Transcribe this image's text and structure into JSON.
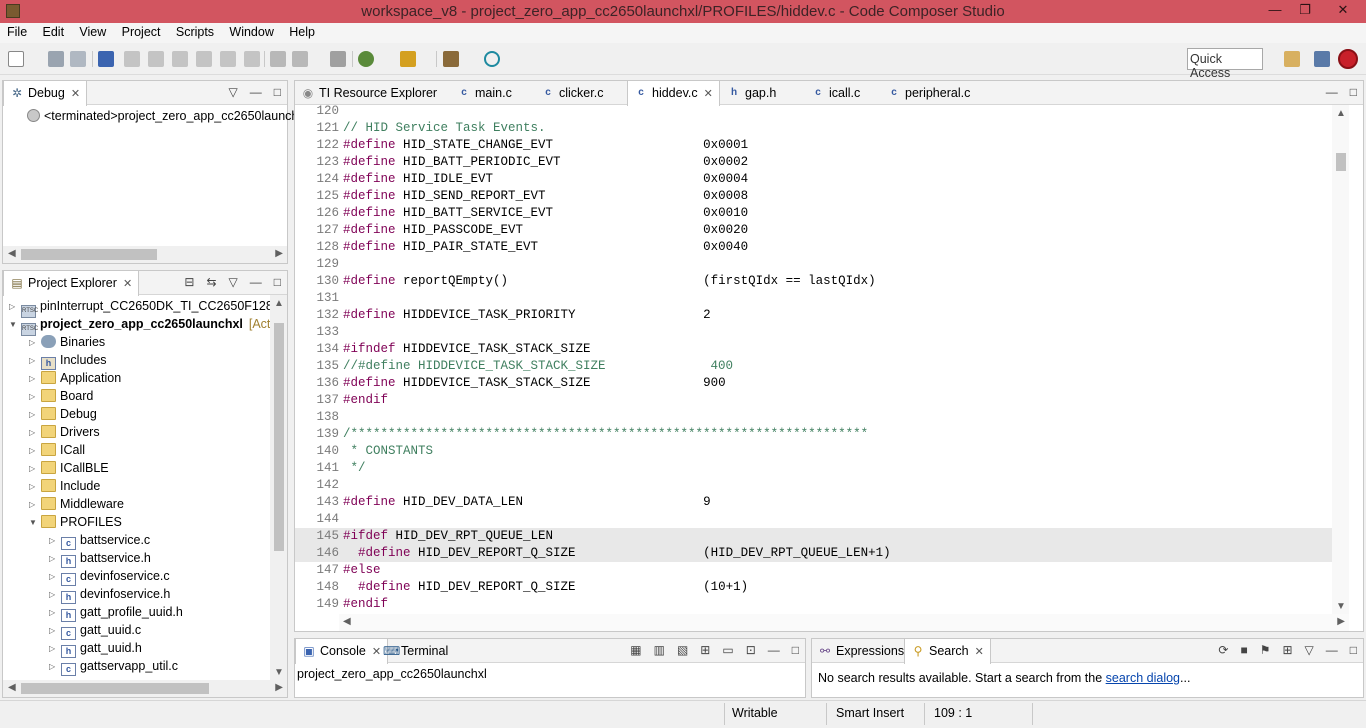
{
  "window": {
    "title": "workspace_v8 - project_zero_app_cc2650launchxl/PROFILES/hiddev.c - Code Composer Studio",
    "min_glyph": "—",
    "restore_glyph": "❐",
    "close_glyph": "✕"
  },
  "menu": [
    "File",
    "Edit",
    "View",
    "Project",
    "Scripts",
    "Window",
    "Help"
  ],
  "quick_access": "Quick Access",
  "debug_view": {
    "tab_label": "Debug",
    "item": "<terminated>project_zero_app_cc2650launch"
  },
  "project_explorer": {
    "tab_label": "Project Explorer",
    "items": [
      {
        "label": "pinInterrupt_CC2650DK_TI_CC2650F128",
        "icon": "project-icon",
        "bold": false
      },
      {
        "label": "project_zero_app_cc2650launchxl",
        "suffix": "[Activ",
        "icon": "project-icon",
        "bold": true
      },
      {
        "label": "Binaries",
        "icon": "binaries-icon"
      },
      {
        "label": "Includes",
        "icon": "includes-icon"
      },
      {
        "label": "Application",
        "icon": "folder-icon"
      },
      {
        "label": "Board",
        "icon": "folder-icon"
      },
      {
        "label": "Debug",
        "icon": "folder-icon"
      },
      {
        "label": "Drivers",
        "icon": "folder-icon"
      },
      {
        "label": "ICall",
        "icon": "folder-icon"
      },
      {
        "label": "ICallBLE",
        "icon": "folder-icon"
      },
      {
        "label": "Include",
        "icon": "folder-icon"
      },
      {
        "label": "Middleware",
        "icon": "folder-icon"
      },
      {
        "label": "PROFILES",
        "icon": "folder-icon"
      },
      {
        "label": "battservice.c",
        "icon": "c-file-icon"
      },
      {
        "label": "battservice.h",
        "icon": "h-file-icon"
      },
      {
        "label": "devinfoservice.c",
        "icon": "c-file-icon"
      },
      {
        "label": "devinfoservice.h",
        "icon": "h-file-icon"
      },
      {
        "label": "gatt_profile_uuid.h",
        "icon": "h-file-icon"
      },
      {
        "label": "gatt_uuid.c",
        "icon": "c-file-icon"
      },
      {
        "label": "gatt_uuid.h",
        "icon": "h-file-icon"
      },
      {
        "label": "gattservapp_util.c",
        "icon": "c-file-icon"
      }
    ]
  },
  "editor": {
    "tabs": [
      {
        "label": "TI Resource Explorer",
        "icon": "resource-explorer-icon"
      },
      {
        "label": "main.c",
        "icon": "c-file-icon"
      },
      {
        "label": "clicker.c",
        "icon": "c-file-icon"
      },
      {
        "label": "hiddev.c",
        "icon": "c-file-icon",
        "active": true
      },
      {
        "label": "gap.h",
        "icon": "h-file-icon"
      },
      {
        "label": "icall.c",
        "icon": "c-file-icon"
      },
      {
        "label": "peripheral.c",
        "icon": "c-file-icon"
      }
    ],
    "lines": [
      {
        "n": "120",
        "text": ""
      },
      {
        "n": "121",
        "text": "// HID Service Task Events.",
        "kind": "comment"
      },
      {
        "n": "122",
        "text": "#define HID_STATE_CHANGE_EVT                    0x0001",
        "kind": "define"
      },
      {
        "n": "123",
        "text": "#define HID_BATT_PERIODIC_EVT                   0x0002",
        "kind": "define"
      },
      {
        "n": "124",
        "text": "#define HID_IDLE_EVT                            0x0004",
        "kind": "define"
      },
      {
        "n": "125",
        "text": "#define HID_SEND_REPORT_EVT                     0x0008",
        "kind": "define"
      },
      {
        "n": "126",
        "text": "#define HID_BATT_SERVICE_EVT                    0x0010",
        "kind": "define"
      },
      {
        "n": "127",
        "text": "#define HID_PASSCODE_EVT                        0x0020",
        "kind": "define"
      },
      {
        "n": "128",
        "text": "#define HID_PAIR_STATE_EVT                      0x0040",
        "kind": "define"
      },
      {
        "n": "129",
        "text": ""
      },
      {
        "n": "130",
        "text": "#define reportQEmpty()                          (firstQIdx == lastQIdx)",
        "kind": "define"
      },
      {
        "n": "131",
        "text": ""
      },
      {
        "n": "132",
        "text": "#define HIDDEVICE_TASK_PRIORITY                 2",
        "kind": "define"
      },
      {
        "n": "133",
        "text": ""
      },
      {
        "n": "134",
        "text": "#ifndef HIDDEVICE_TASK_STACK_SIZE",
        "kind": "ifndef"
      },
      {
        "n": "135",
        "text": "//#define HIDDEVICE_TASK_STACK_SIZE              400",
        "kind": "comment"
      },
      {
        "n": "136",
        "text": "#define HIDDEVICE_TASK_STACK_SIZE               900",
        "kind": "define"
      },
      {
        "n": "137",
        "text": "#endif",
        "kind": "endif"
      },
      {
        "n": "138",
        "text": ""
      },
      {
        "n": "139",
        "text": "/*********************************************************************",
        "kind": "comment"
      },
      {
        "n": "140",
        "text": " * CONSTANTS",
        "kind": "comment"
      },
      {
        "n": "141",
        "text": " */",
        "kind": "comment"
      },
      {
        "n": "142",
        "text": ""
      },
      {
        "n": "143",
        "text": "#define HID_DEV_DATA_LEN                        9",
        "kind": "define"
      },
      {
        "n": "144",
        "text": ""
      },
      {
        "n": "145",
        "text": "#ifdef HID_DEV_RPT_QUEUE_LEN",
        "kind": "ifdef",
        "highlight": true
      },
      {
        "n": "146",
        "text": "  #define HID_DEV_REPORT_Q_SIZE                 (HID_DEV_RPT_QUEUE_LEN+1)",
        "kind": "define",
        "highlight": true
      },
      {
        "n": "147",
        "text": "#else",
        "kind": "else"
      },
      {
        "n": "148",
        "text": "  #define HID_DEV_REPORT_Q_SIZE                 (10+1)",
        "kind": "define"
      },
      {
        "n": "149",
        "text": "#endif",
        "kind": "endif"
      }
    ]
  },
  "console": {
    "tabs": [
      {
        "label": "Console",
        "icon": "console-icon",
        "active": true
      },
      {
        "label": "Terminal",
        "icon": "terminal-icon"
      }
    ],
    "text": "project_zero_app_cc2650launchxl"
  },
  "search": {
    "tabs": [
      {
        "label": "Expressions",
        "icon": "expressions-icon"
      },
      {
        "label": "Search",
        "icon": "search-icon",
        "active": true
      }
    ],
    "message": "No search results available. Start a search from the ",
    "link": "search dialog",
    "suffix": "..."
  },
  "status": {
    "writable": "Writable",
    "insert_mode": "Smart Insert",
    "position": "109 : 1"
  },
  "colors": {
    "titlebar": "#d25560",
    "keyword": "#7f0055",
    "comment": "#3f7f5f",
    "link": "#0645ad"
  }
}
